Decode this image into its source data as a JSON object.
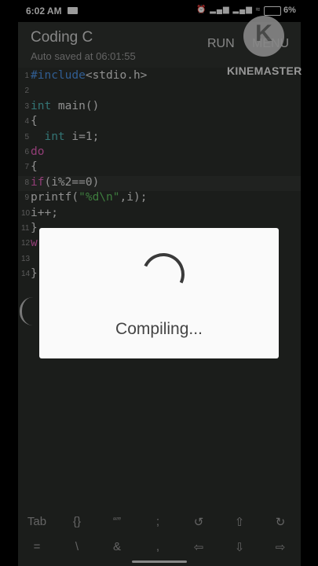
{
  "status": {
    "time": "6:02 AM",
    "battery": "6%",
    "signal_icons": "⏰ ▂▄▆ ▂▄▆ ≈"
  },
  "app": {
    "title": "Coding C",
    "subtitle": "Auto saved at 06:01:55",
    "run_label": "RUN",
    "menu_label": "MENU"
  },
  "editor": {
    "lines": [
      {
        "num": "1",
        "parts": [
          {
            "t": "#include",
            "c": "kw-blue"
          },
          {
            "t": "<stdio.h>",
            "c": ""
          }
        ]
      },
      {
        "num": "2",
        "parts": []
      },
      {
        "num": "3",
        "parts": [
          {
            "t": "int",
            "c": "kw-teal"
          },
          {
            "t": " main()",
            "c": ""
          }
        ]
      },
      {
        "num": "4",
        "parts": [
          {
            "t": "{",
            "c": ""
          }
        ]
      },
      {
        "num": "5",
        "parts": [
          {
            "t": "  int",
            "c": "kw-teal"
          },
          {
            "t": " i=1;",
            "c": ""
          }
        ]
      },
      {
        "num": "6",
        "parts": [
          {
            "t": "do",
            "c": "kw-pink"
          }
        ]
      },
      {
        "num": "7",
        "parts": [
          {
            "t": "{",
            "c": ""
          }
        ]
      },
      {
        "num": "8",
        "parts": [
          {
            "t": "if",
            "c": "kw-pink"
          },
          {
            "t": "(i%2==0)",
            "c": ""
          }
        ]
      },
      {
        "num": "9",
        "parts": [
          {
            "t": "printf(",
            "c": ""
          },
          {
            "t": "\"%d\\n\"",
            "c": "str"
          },
          {
            "t": ",i);",
            "c": ""
          }
        ]
      },
      {
        "num": "10",
        "parts": [
          {
            "t": "i++;",
            "c": ""
          }
        ]
      },
      {
        "num": "11",
        "parts": [
          {
            "t": "}",
            "c": ""
          }
        ]
      },
      {
        "num": "12",
        "parts": [
          {
            "t": "w",
            "c": "kw-pink"
          }
        ]
      },
      {
        "num": "13",
        "parts": []
      },
      {
        "num": "14",
        "parts": [
          {
            "t": "}",
            "c": ""
          }
        ]
      }
    ],
    "highlighted_line": "8"
  },
  "dialog": {
    "text": "Compiling..."
  },
  "keys": {
    "row1": [
      "Tab",
      "{}",
      "“”",
      ";",
      "↺",
      "⇧",
      "↻"
    ],
    "row2": [
      "=",
      "\\",
      "&",
      ",",
      "⇦",
      "⇩",
      "⇨"
    ]
  },
  "watermark": {
    "logo_letter": "K",
    "text": "KINEMASTER"
  }
}
